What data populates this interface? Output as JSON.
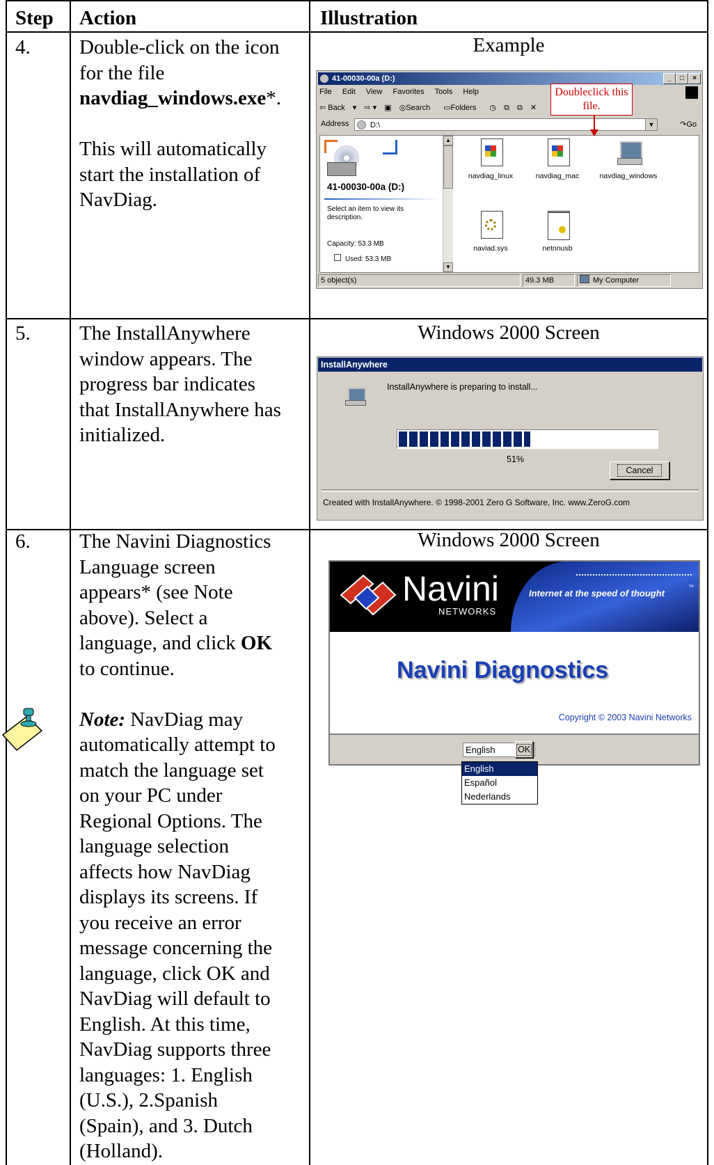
{
  "table": {
    "headers": {
      "step": "Step",
      "action": "Action",
      "illustration": "Illustration"
    },
    "rows": [
      {
        "step": "4.",
        "action": {
          "lines": [
            "Double-click on the icon",
            "for the file"
          ],
          "filename": "navdiag_windows.exe",
          "filename_suffix": "*.",
          "paragraph2": [
            "This will automatically",
            "start the installation of",
            "NavDiag."
          ]
        },
        "caption": "Example"
      },
      {
        "step": "5.",
        "action": {
          "lines": [
            "The InstallAnywhere",
            "window appears. The",
            "progress bar indicates",
            "that InstallAnywhere has",
            "initialized."
          ]
        },
        "caption": "Windows 2000 Screen"
      },
      {
        "step": "6.",
        "action": {
          "lines": [
            "The Navini Diagnostics",
            "Language screen",
            "appears* (see Note",
            "above). Select a"
          ],
          "line5_pre": "language, and click ",
          "line5_bold": "OK",
          "line6": "to continue.",
          "note_label": "Note:",
          "note_first": " NavDiag may",
          "note_lines": [
            "automatically attempt to",
            "match the language set",
            "on your PC under",
            "Regional Options. The",
            "language selection",
            "affects how NavDiag",
            "displays its screens. If",
            "you receive an error",
            "message concerning the",
            "language, click OK and",
            "NavDiag will default to",
            "English. At this time,",
            "NavDiag supports three",
            "languages: 1. English",
            "(U.S.),  2.Spanish",
            "(Spain), and  3. Dutch",
            "(Holland)."
          ]
        },
        "caption": "Windows 2000 Screen"
      }
    ]
  },
  "explorer": {
    "title": "41-00030-00a (D:)",
    "menu": [
      "File",
      "Edit",
      "View",
      "Favorites",
      "Tools",
      "Help"
    ],
    "toolbar": [
      "Back",
      "Search",
      "Folders"
    ],
    "address_label": "Address",
    "address_value": "D:\\",
    "go_label": "Go",
    "drive_label": "41-00030-00a (D:)",
    "select_hint": "Select an item to view its description.",
    "capacity": "Capacity: 53.3 MB",
    "used": "Used: 53.3 MB",
    "files": [
      "navdiag_linux",
      "navdiag_mac",
      "navdiag_windows",
      "naviad.sys",
      "netnnusb"
    ],
    "callout": "Doubleclick this file.",
    "status": {
      "objects": "5 object(s)",
      "size": "49.3 MB",
      "location": "My Computer"
    }
  },
  "install_anywhere": {
    "title": "InstallAnywhere",
    "message": "InstallAnywhere is preparing to install...",
    "progress_text": "51%",
    "progress_fraction": 0.51,
    "cancel_label": "Cancel",
    "footer": "Created with InstallAnywhere. © 1998-2001 Zero G Software, Inc.  www.ZeroG.com"
  },
  "navini": {
    "logo_name": "Navini",
    "logo_sub": "NETWORKS",
    "tagline": "Internet at the speed of thought",
    "tm": "™",
    "product": "Navini Diagnostics",
    "copyright": "Copyright © 2003 Navini Networks",
    "selected_language": "English",
    "ok_label": "OK",
    "options": [
      "English",
      "Español",
      "Nederlands"
    ]
  },
  "colors": {
    "callout_red": "#cc0000",
    "win_blue": "#0a246a",
    "navini_blue": "#1a3fb5"
  }
}
